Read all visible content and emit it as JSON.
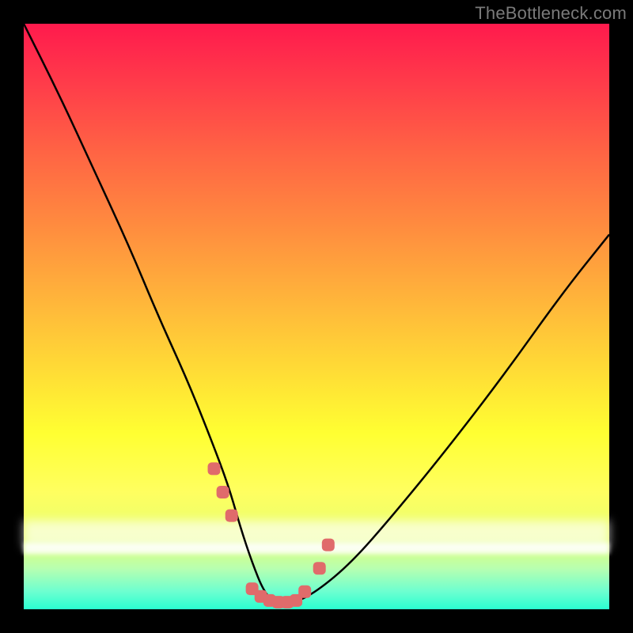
{
  "watermark": "TheBottleneck.com",
  "chart_data": {
    "type": "line",
    "title": "",
    "xlabel": "",
    "ylabel": "",
    "xlim": [
      0,
      100
    ],
    "ylim": [
      0,
      100
    ],
    "grid": false,
    "background": "rainbow-gradient-red-to-green",
    "series": [
      {
        "name": "bottleneck-curve",
        "color": "#000000",
        "x": [
          0,
          6,
          12,
          18,
          23,
          28,
          32,
          35,
          37,
          39,
          41,
          43,
          46,
          50,
          56,
          63,
          72,
          82,
          92,
          100
        ],
        "y": [
          100,
          88,
          75,
          62,
          50,
          39,
          29,
          21,
          14,
          8,
          3,
          1,
          1,
          3,
          8,
          16,
          27,
          40,
          54,
          64
        ]
      },
      {
        "name": "bottleneck-markers",
        "color": "#e06b6b",
        "marker": "rounded-square",
        "x": [
          32.5,
          34,
          35.5,
          39,
          40.5,
          42,
          43.5,
          45,
          46.5,
          48,
          50.5,
          52
        ],
        "y": [
          24,
          20,
          16,
          3.5,
          2.2,
          1.5,
          1.2,
          1.2,
          1.5,
          3,
          7,
          11
        ]
      }
    ]
  }
}
